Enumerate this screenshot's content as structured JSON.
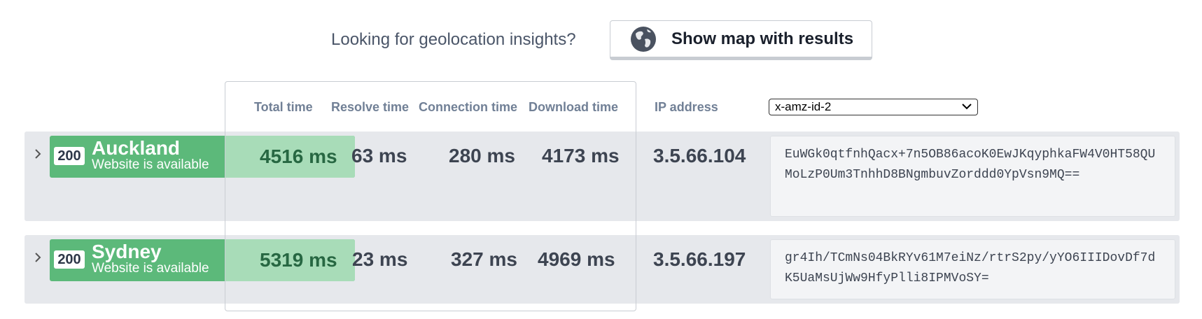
{
  "promo": {
    "question": "Looking for geolocation insights?",
    "button_label": "Show map with results",
    "button_icon": "globe-icon"
  },
  "columns": {
    "total": "Total time",
    "resolve": "Resolve time",
    "connection": "Connection time",
    "download": "Download time",
    "ip": "IP address"
  },
  "header_select": {
    "selected": "x-amz-id-2"
  },
  "rows": [
    {
      "status_code": "200",
      "city": "Auckland",
      "availability": "Website is available",
      "total": "4516 ms",
      "resolve": "63 ms",
      "connection": "280 ms",
      "download": "4173 ms",
      "ip": "3.5.66.104",
      "header_value": "EuWGk0qtfnhQacx+7n5OB86acoK0EwJKqyphkaFW4V0HT58QUMoLzP0Um3TnhhD8BNgmbuvZorddd0YpVsn9MQ=="
    },
    {
      "status_code": "200",
      "city": "Sydney",
      "availability": "Website is available",
      "total": "5319 ms",
      "resolve": "23 ms",
      "connection": "327 ms",
      "download": "4969 ms",
      "ip": "3.5.66.197",
      "header_value": "gr4Ih/TCmNs04BkRYv61M7eiNz/rtrS2py/yYO6IIIDovDf7dK5UaMsUjWw9HfyPlli8IPMVoSY="
    }
  ],
  "colors": {
    "status_green": "#5cb97a",
    "fast_green": "#a8dcb8",
    "row_bg": "#e6e8ec"
  }
}
